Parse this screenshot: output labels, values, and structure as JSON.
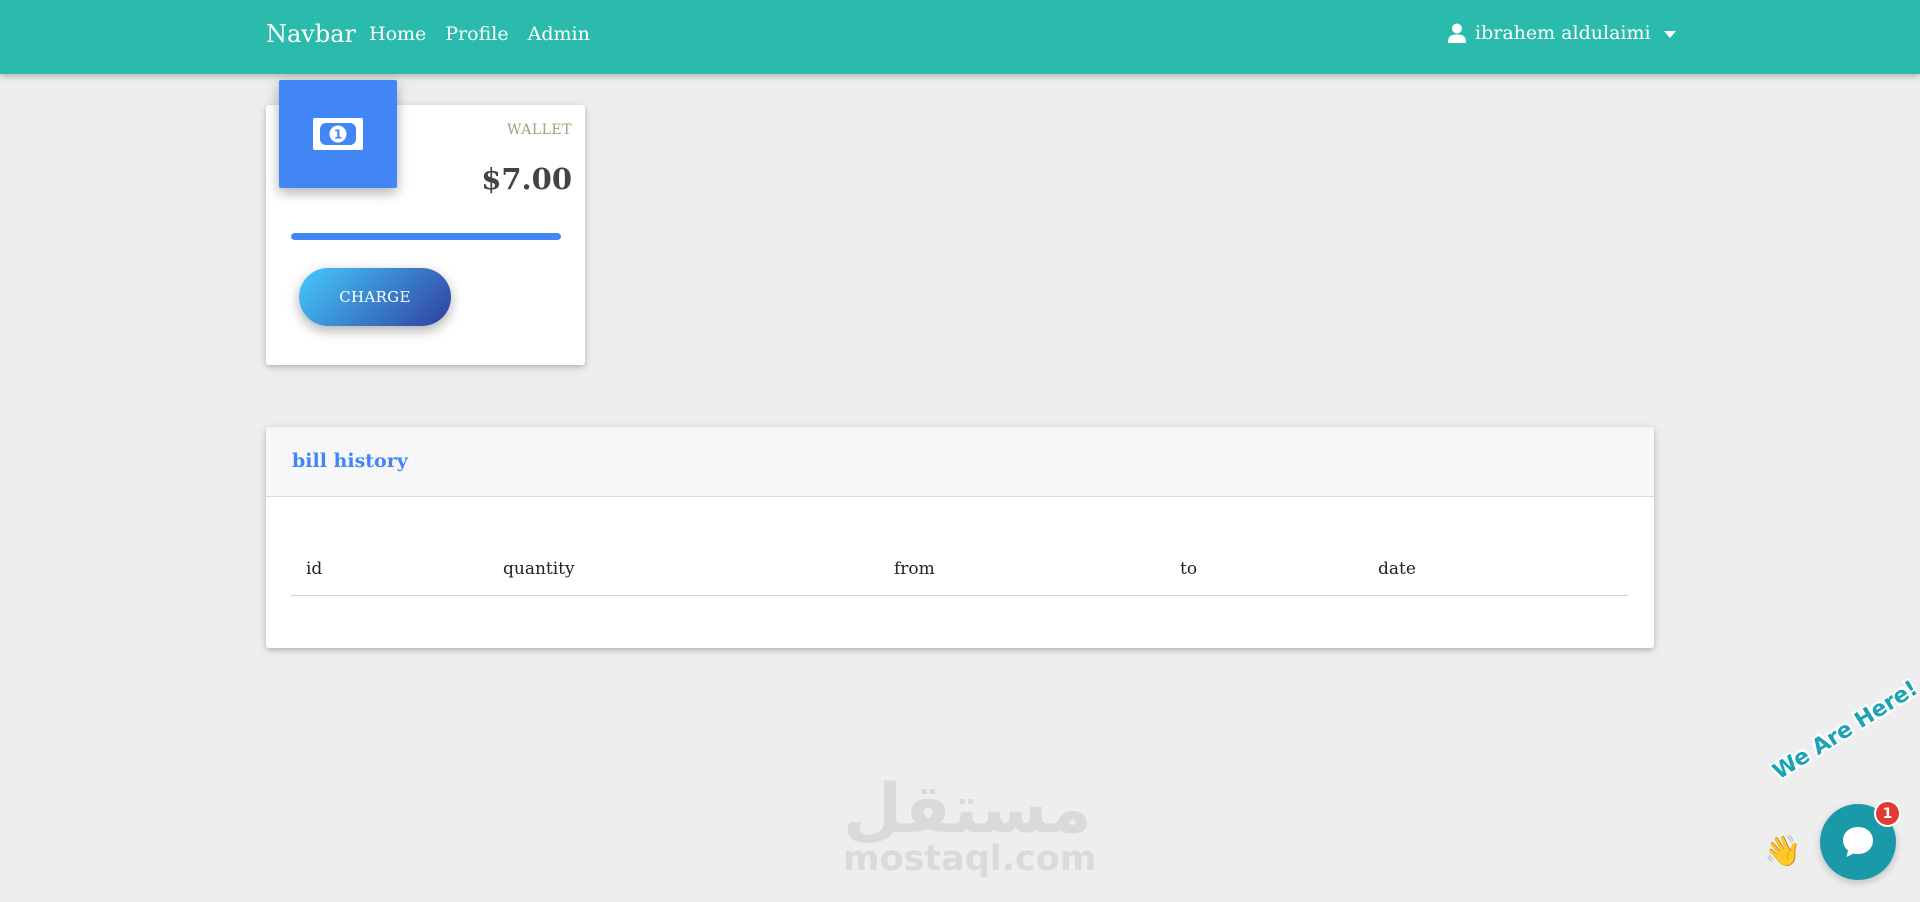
{
  "navbar": {
    "brand": "Navbar",
    "links": [
      {
        "label": "Home"
      },
      {
        "label": "Profile"
      },
      {
        "label": "Admin"
      }
    ],
    "user": {
      "name": "ibrahem aldulaimi",
      "icon": "user-icon"
    },
    "color": "#2bbbad"
  },
  "wallet": {
    "label": "WALLET",
    "amount": "$7.00",
    "icon": "money-bill-icon",
    "progress": 1.0,
    "charge_label": "CHARGE",
    "accent": "#4285f4"
  },
  "bill_history": {
    "title": "bill history",
    "columns": [
      "id",
      "quantity",
      "from",
      "to",
      "date"
    ],
    "rows": []
  },
  "watermark": {
    "arabic": "مستقل",
    "latin": "mostaql.com"
  },
  "chat_widget": {
    "tagline": "We Are Here!",
    "badge_count": "1",
    "icon": "chat-bubble-icon"
  }
}
